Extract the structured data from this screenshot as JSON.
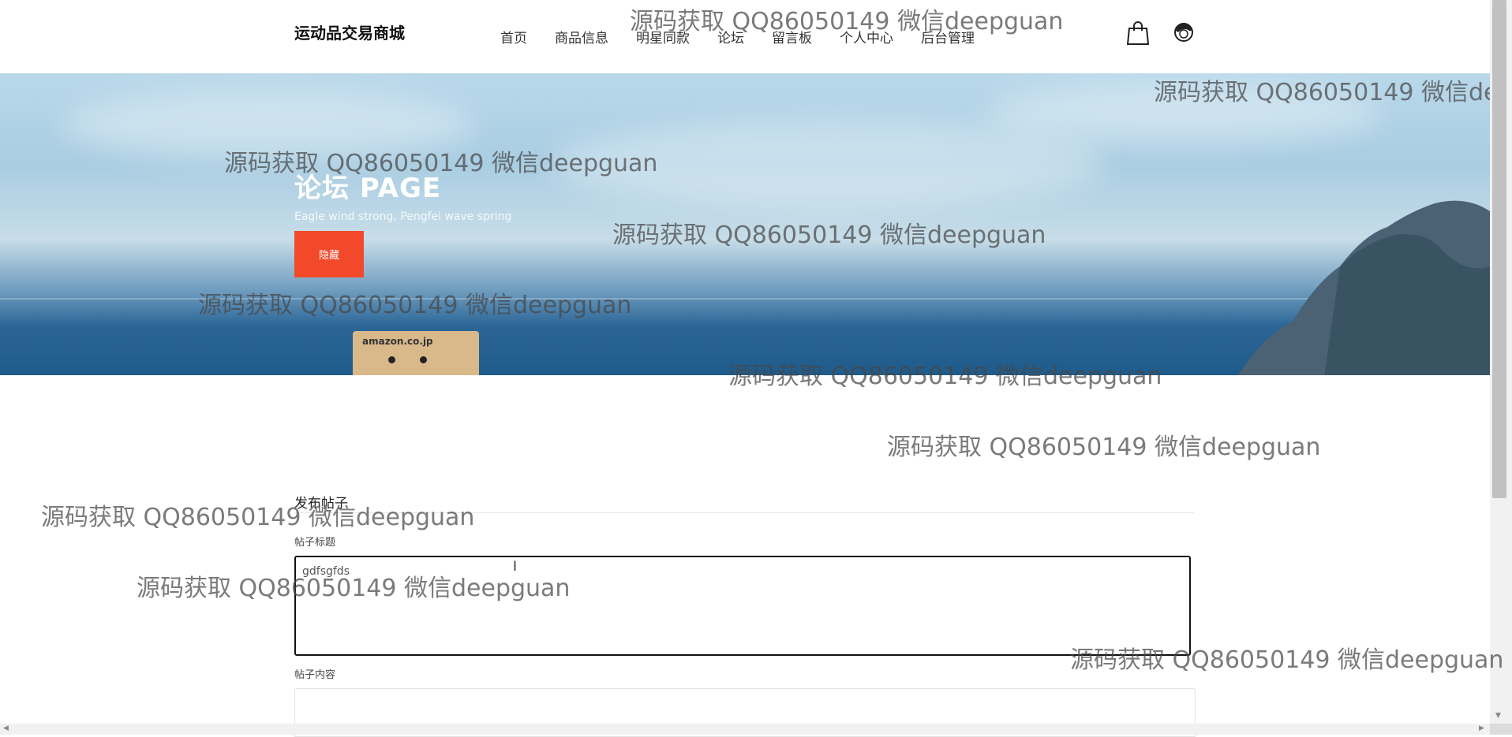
{
  "header": {
    "site_title": "运动品交易商城",
    "nav": [
      "首页",
      "商品信息",
      "明星同款",
      "论坛",
      "留言板",
      "个人中心",
      "后台管理"
    ],
    "cart_icon": "shopping-bag-icon",
    "user_icon": "user-avatar-icon"
  },
  "banner": {
    "title": "论坛 PAGE",
    "subtitle": "Eagle wind strong, Pengfei wave spring",
    "hide_button": "隐藏",
    "box_label": "amazon.co.jp"
  },
  "form": {
    "heading": "发布帖子",
    "title_label": "帖子标题",
    "title_value": "gdfsgfds",
    "content_label": "帖子内容",
    "content_value": ""
  },
  "watermark": "源码获取 QQ86050149 微信deepguan",
  "colors": {
    "accent": "#f2492b",
    "text": "#333333"
  }
}
